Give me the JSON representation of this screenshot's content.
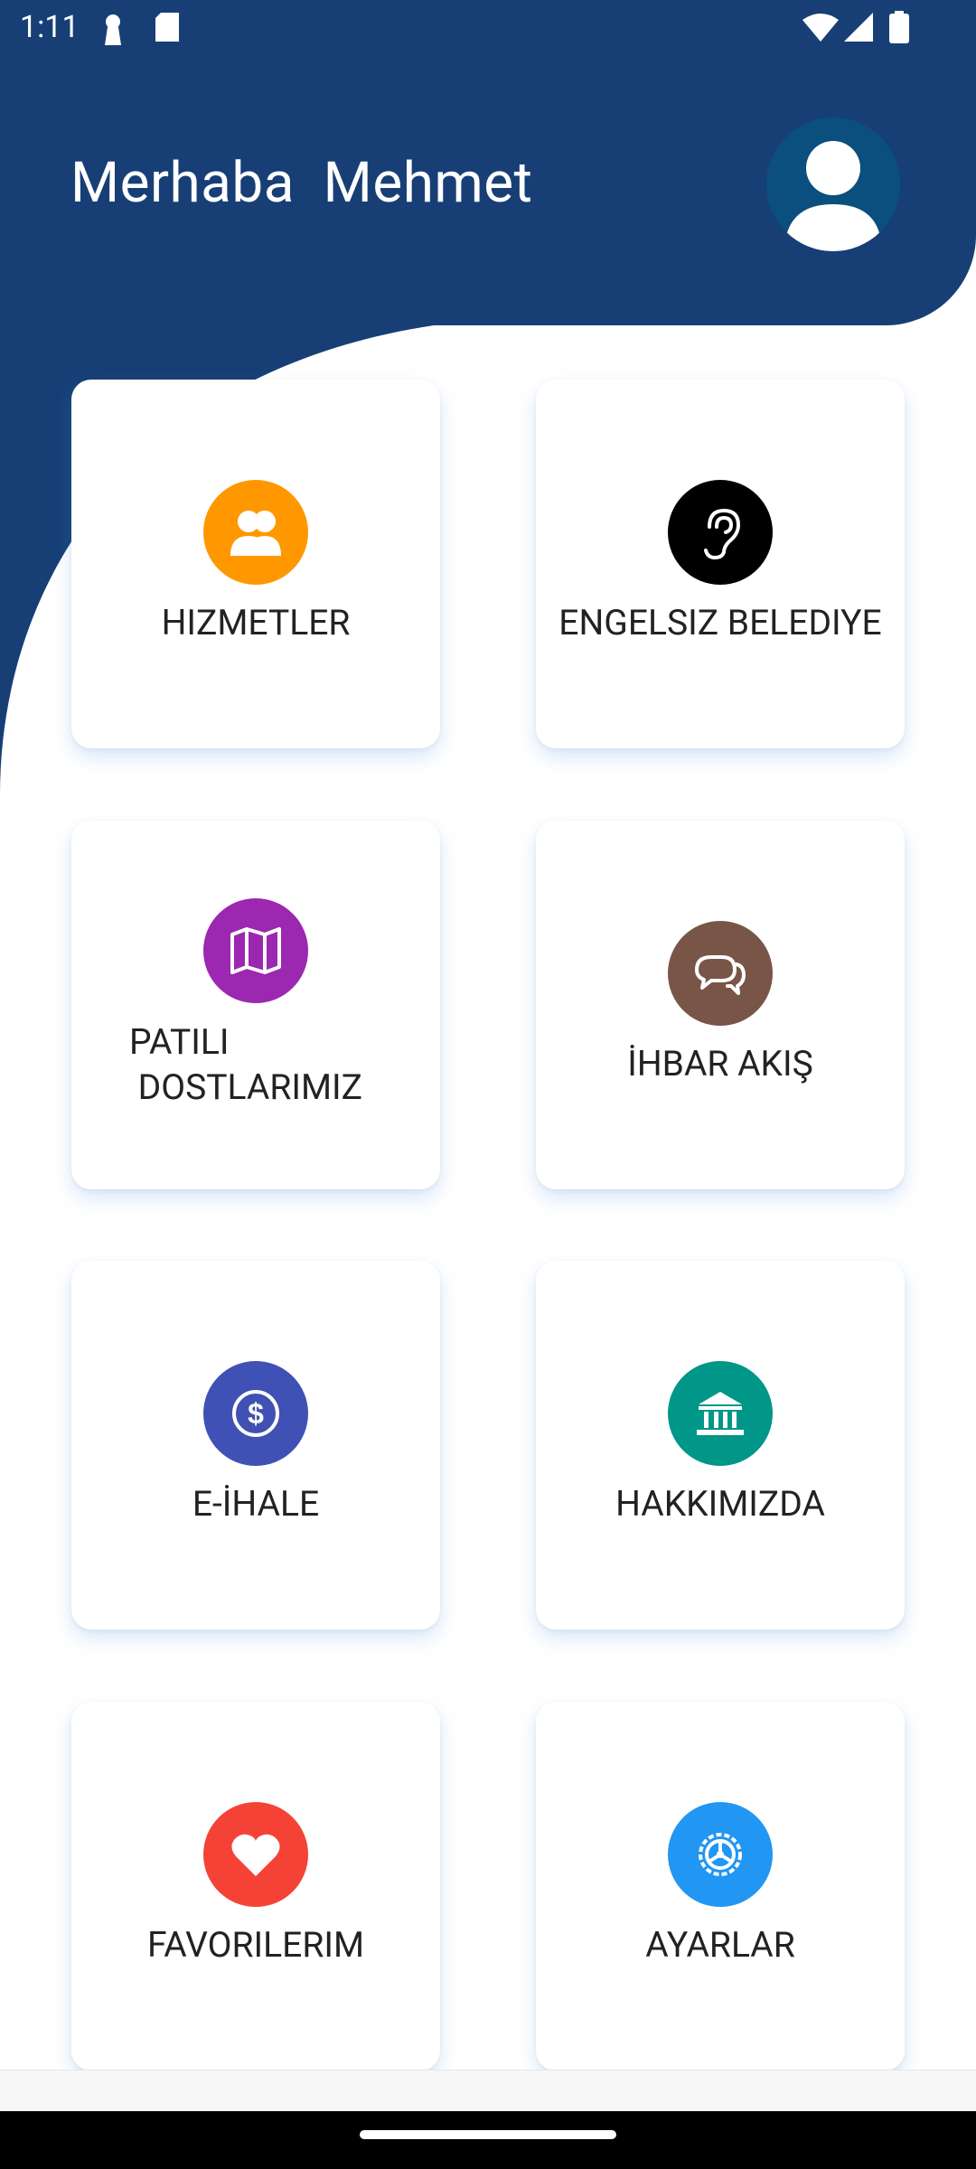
{
  "status_bar": {
    "time": "1:11"
  },
  "header": {
    "greeting": "Merhaba  Mehmet"
  },
  "menu": [
    {
      "label": "HIZMETLER",
      "icon": "users-icon",
      "color": "#ff9800"
    },
    {
      "label": "ENGELSIZ BELEDIYE",
      "icon": "ear-icon",
      "color": "#000000"
    },
    {
      "label": "PATILI\n DOSTLARIMIZ",
      "icon": "map-icon",
      "color": "#9c27b0"
    },
    {
      "label": "İHBAR AKIŞ",
      "icon": "chat-icon",
      "color": "#795548"
    },
    {
      "label": "E-İHALE",
      "icon": "dollar-icon",
      "color": "#3f51b5"
    },
    {
      "label": "HAKKIMIZDA",
      "icon": "bank-icon",
      "color": "#009688"
    },
    {
      "label": "FAVORILERIM",
      "icon": "heart-icon",
      "color": "#f44336"
    },
    {
      "label": "AYARLAR",
      "icon": "settings-icon",
      "color": "#2196f3"
    }
  ],
  "colors": {
    "header": "#173f76",
    "avatar": "#0a4f7d"
  }
}
